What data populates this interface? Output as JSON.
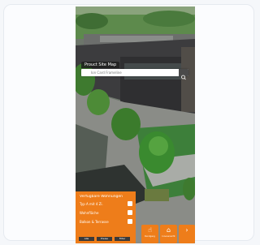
{
  "search": {
    "title": "Prouct Site Map",
    "placeholder": "Ion Card Frameline",
    "button_icon": "search-icon"
  },
  "panel": {
    "title": "Verfügbare Wohnungen",
    "rows": [
      {
        "label": "Typ A mit 4 Zi."
      },
      {
        "label": "Wohnfläche"
      },
      {
        "label": "Balkon & Terrasse"
      }
    ],
    "buttons": [
      "Alle",
      "Preise",
      "Filter"
    ]
  },
  "tiles": [
    {
      "label": "Rundgang",
      "icon": "cursor-icon"
    },
    {
      "label": "Innenansicht",
      "icon": "building-icon"
    },
    {
      "label": "",
      "icon": "arrow-icon"
    }
  ],
  "colors": {
    "accent": "#ee7d1a",
    "dark": "#3a3a3a",
    "frame_border": "#e6eaf0"
  }
}
